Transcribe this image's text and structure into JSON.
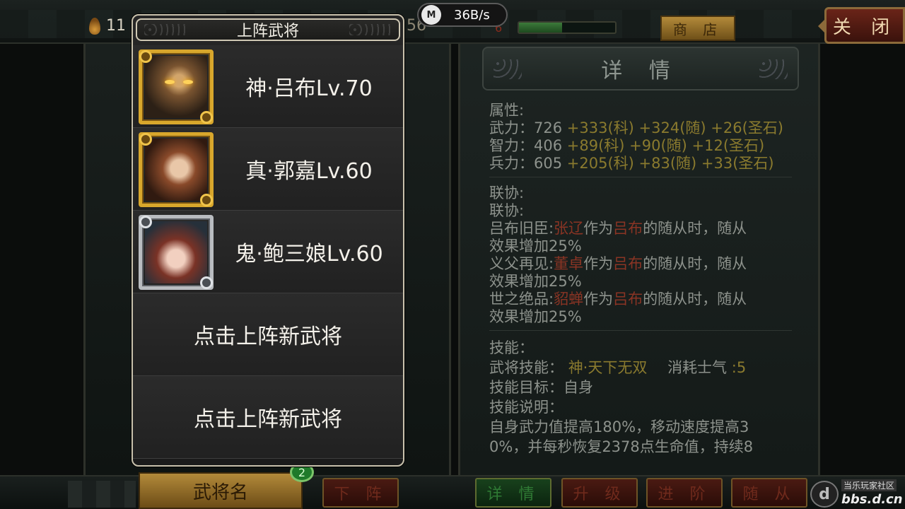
{
  "topbar": {
    "resource_value": "11",
    "resource2_value": "56",
    "red_mark": "6",
    "progress_fraction": 0.45,
    "shop_label": "商 店",
    "close_label": "关 闭"
  },
  "overlay": {
    "speed": "36B/s",
    "badge": "M"
  },
  "popup": {
    "title": "上阵武将",
    "generals": [
      {
        "name": "神·吕布Lv.70",
        "frame": "gold"
      },
      {
        "name": "真·郭嘉Lv.60",
        "frame": "gold"
      },
      {
        "name": "鬼·鲍三娘Lv.60",
        "frame": "silver"
      }
    ],
    "empty_slots": [
      "点击上阵新武将",
      "点击上阵新武将"
    ]
  },
  "detail": {
    "header": "详 情",
    "attr_label": "属性:",
    "attrs": [
      {
        "label": "武力：726",
        "bonus": "+333(科) +324(随) +26(圣石)"
      },
      {
        "label": "智力：406",
        "bonus": "+89(科) +90(随) +12(圣石)"
      },
      {
        "label": "兵力：605",
        "bonus": "+205(科) +83(随) +33(圣石)"
      }
    ],
    "synergy_label1": "联协:",
    "synergy_label2": "联协:",
    "synergies": [
      {
        "name": "吕布旧臣:",
        "target": "张辽",
        "mid": "作为",
        "owner": "吕布",
        "tail": "的随从时，随从",
        "effect": "效果增加25%"
      },
      {
        "name": "义父再见:",
        "target": "董卓",
        "mid": "作为",
        "owner": "吕布",
        "tail": "的随从时，随从",
        "effect": "效果增加25%"
      },
      {
        "name": "世之绝品:",
        "target": "貂蝉",
        "mid": "作为",
        "owner": "吕布",
        "tail": "的随从时，随从",
        "effect": "效果增加25%"
      }
    ],
    "skill_label": "技能：",
    "skill_name_label": "武将技能：",
    "skill_name": "神·天下无双",
    "cost_label": "消耗士气",
    "cost_value": ":5",
    "target_label": "技能目标：自身",
    "desc_label": "技能说明：",
    "desc_line1": "自身武力值提高180%，移动速度提高3",
    "desc_line2": "0%，并每秒恢复2378点生命值，持续8"
  },
  "bottombar": {
    "name_tab": "武将名",
    "count": "2",
    "buttons": [
      "下 阵",
      "详 情",
      "升 级",
      "进 阶",
      "随 从"
    ],
    "watermark_line1": "当乐玩家社区",
    "watermark_line2": "bbs.d.cn",
    "watermark_logo": "d"
  },
  "colors": {
    "gold_frame": "#d8a72c",
    "silver_frame": "#b9bcc0",
    "bonus_yellow": "#8a7a2e",
    "name_red": "#8a3424"
  }
}
